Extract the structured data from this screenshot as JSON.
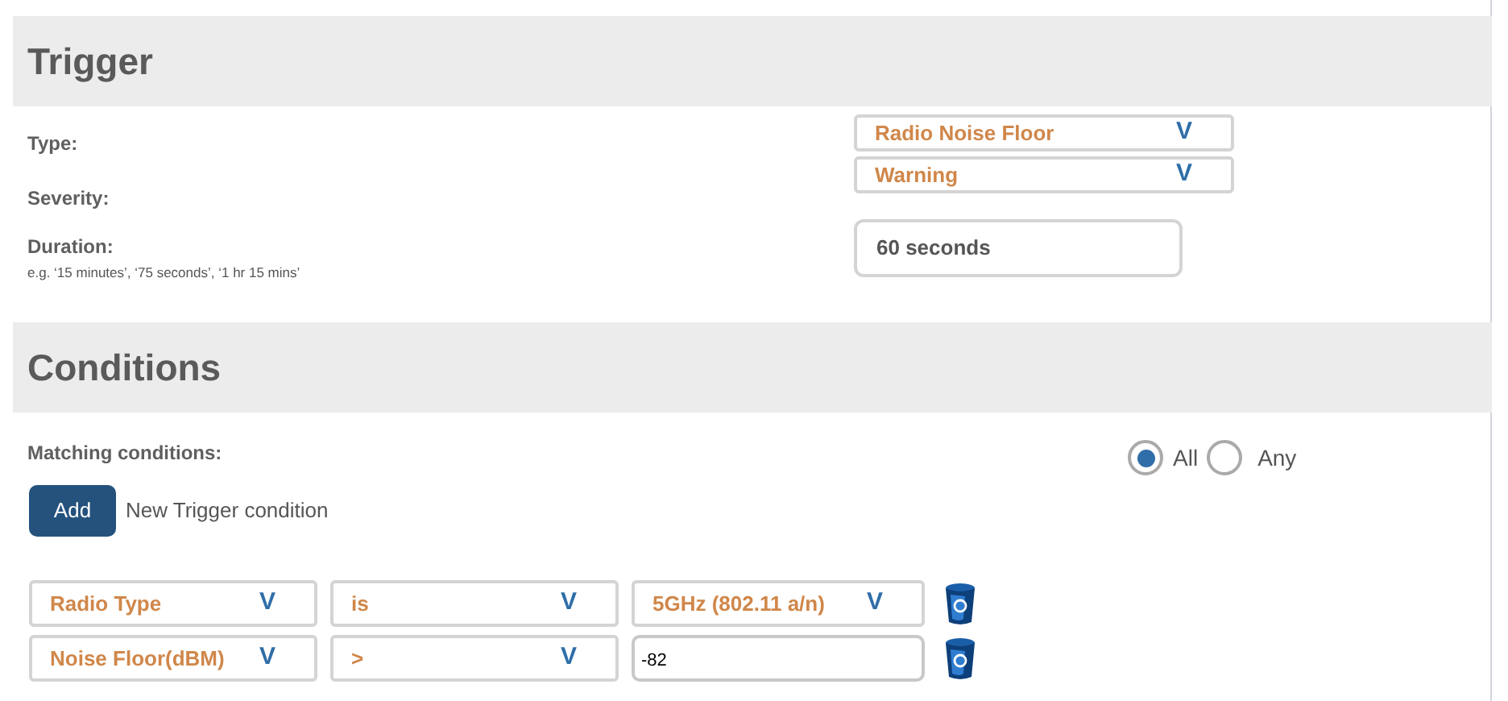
{
  "trigger": {
    "title": "Trigger",
    "fields": [
      {
        "kind": "select",
        "label": "Type:",
        "value": "Radio Noise Floor",
        "caret": "V"
      },
      {
        "kind": "select",
        "label": "Severity:",
        "value": "Warning",
        "caret": "V"
      },
      {
        "kind": "text",
        "label": "Duration:",
        "hint": "e.g. ‘15 minutes’, ‘75 seconds’, ‘1 hr 15 mins’",
        "value": "60 seconds"
      }
    ]
  },
  "conditions": {
    "title": "Conditions",
    "matching_label": "Matching conditions:",
    "matching_options": [
      {
        "label": "All",
        "selected": true
      },
      {
        "label": "Any",
        "selected": false
      }
    ],
    "add_button": "Add",
    "add_hint": "New Trigger condition",
    "rows": [
      [
        {
          "kind": "select",
          "value": "Radio Type",
          "caret": "V"
        },
        {
          "kind": "select",
          "value": "is",
          "caret": "V"
        },
        {
          "kind": "select",
          "value": "5GHz (802.11 a/n)",
          "caret": "V"
        }
      ],
      [
        {
          "kind": "select",
          "value": "Noise Floor(dBM)",
          "caret": "V"
        },
        {
          "kind": "select",
          "value": ">",
          "caret": "V"
        },
        {
          "kind": "textarea",
          "value": "-82"
        }
      ]
    ]
  }
}
